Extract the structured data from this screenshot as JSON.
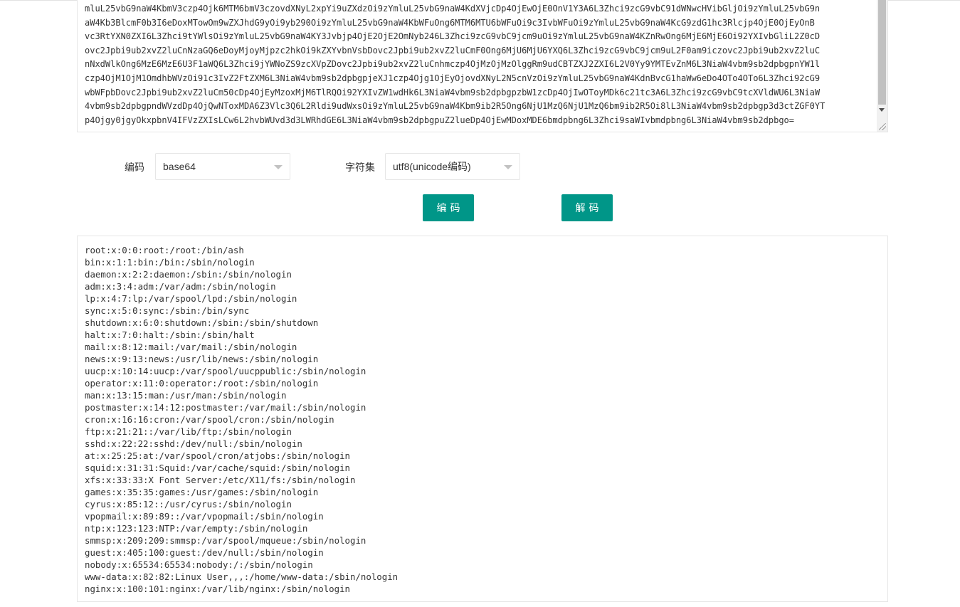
{
  "input": {
    "lines": [
      "mluL25vbG9naW4KbmV3czp4Ojk6MTM6bmV3czovdXNyL2xpYi9uZXdzOi9zYmluL25vbG9naW4KdXVjcDp4OjEwOjE0OnV1Y3A6L3Zhci9zcG9vbC91dWNwcHVibGljOi9zYmluL25vbG9n",
      "aW4Kb3BlcmF0b3I6eDoxMTowOm9wZXJhdG9yOi9yb290Oi9zYmluL25vbG9naW4KbWFuOng6MTM6MTU6bWFuOi9c3IvbWFuOi9zYmluL25vbG9naW4KcG9zdG1hc3Rlcjp4OjE0OjEyOnB",
      "vc3RtYXN0ZXI6L3Zhci9tYWlsOi9zYmluL25vbG9naW4KY3Jvbjp4OjE2OjE2OmNyb246L3Zhci9zcG9vbC9jcm9uOi9zYmluL25vbG9naW4KZnRwOng6MjE6MjE6Oi92YXIvbGliL2Z0cD",
      "ovc2Jpbi9ub2xvZ2luCnNzaGQ6eDoyMjoyMjpzc2hkOi9kZXYvbnVsbDovc2Jpbi9ub2xvZ2luCmF0Ong6MjU6MjU6YXQ6L3Zhci9zcG9vbC9jcm9uL2F0am9iczovc2Jpbi9ub2xvZ2luC",
      "nNxdWlkOng6MzE6MzE6U3F1aWQ6L3Zhci9jYWNoZS9zcXVpZDovc2Jpbi9ub2xvZ2luCnhmczp4OjMzOjMzOlggRm9udCBTZXJ2ZXI6L2V0Yy9YMTEvZnM6L3NiaW4vbm9sb2dpbgpnYW1l",
      "czp4OjM1OjM1OmdhbWVzOi91c3IvZ2FtZXM6L3NiaW4vbm9sb2dpbgpjeXJ1czp4Ojg1OjEyOjovdXNyL2N5cnVzOi9zYmluL25vbG9naW4KdnBvcG1haWw6eDo4OTo4OTo6L3Zhci92cG9",
      "wbWFpbDovc2Jpbi9ub2xvZ2luCm50cDp4OjEyMzoxMjM6TlRQOi92YXIvZW1wdHk6L3NiaW4vbm9sb2dpbgpzbW1zcDp4OjIwOToyMDk6c21tc3A6L3Zhci9zcG9vbC9tcXVldWU6L3NiaW",
      "4vbm9sb2dpbgpndWVzdDp4OjQwNToxMDA6Z3Vlc3Q6L2Rldi9udWxsOi9zYmluL25vbG9naW4Kbm9ib2R5Ong6NjU1MzQ6NjU1MzQ6bm9ib2R5Oi8lL3NiaW4vbm9sb2dpbgp3d3ctZGF0YT",
      "p4Ojgy0jgyOkxpbnV4IFVzZXIsLCw6L2hvbWUvd3d3LWRhdGE6L3NiaW4vbm9sb2dpbgpuZ2lueDp4OjEwMDoxMDE6bmdpbng6L3Zhci9saWIvbmdpbng6L3NiaW4vbm9sb2dpbgo="
    ]
  },
  "form": {
    "encoding_label": "编码",
    "encoding_value": "base64",
    "charset_label": "字符集",
    "charset_value": "utf8(unicode编码)"
  },
  "buttons": {
    "encode_label": "编码",
    "decode_label": "解码"
  },
  "output": {
    "lines": [
      "root:x:0:0:root:/root:/bin/ash",
      "bin:x:1:1:bin:/bin:/sbin/nologin",
      "daemon:x:2:2:daemon:/sbin:/sbin/nologin",
      "adm:x:3:4:adm:/var/adm:/sbin/nologin",
      "lp:x:4:7:lp:/var/spool/lpd:/sbin/nologin",
      "sync:x:5:0:sync:/sbin:/bin/sync",
      "shutdown:x:6:0:shutdown:/sbin:/sbin/shutdown",
      "halt:x:7:0:halt:/sbin:/sbin/halt",
      "mail:x:8:12:mail:/var/mail:/sbin/nologin",
      "news:x:9:13:news:/usr/lib/news:/sbin/nologin",
      "uucp:x:10:14:uucp:/var/spool/uucppublic:/sbin/nologin",
      "operator:x:11:0:operator:/root:/sbin/nologin",
      "man:x:13:15:man:/usr/man:/sbin/nologin",
      "postmaster:x:14:12:postmaster:/var/mail:/sbin/nologin",
      "cron:x:16:16:cron:/var/spool/cron:/sbin/nologin",
      "ftp:x:21:21::/var/lib/ftp:/sbin/nologin",
      "sshd:x:22:22:sshd:/dev/null:/sbin/nologin",
      "at:x:25:25:at:/var/spool/cron/atjobs:/sbin/nologin",
      "squid:x:31:31:Squid:/var/cache/squid:/sbin/nologin",
      "xfs:x:33:33:X Font Server:/etc/X11/fs:/sbin/nologin",
      "games:x:35:35:games:/usr/games:/sbin/nologin",
      "cyrus:x:85:12::/usr/cyrus:/sbin/nologin",
      "vpopmail:x:89:89::/var/vpopmail:/sbin/nologin",
      "ntp:x:123:123:NTP:/var/empty:/sbin/nologin",
      "smmsp:x:209:209:smmsp:/var/spool/mqueue:/sbin/nologin",
      "guest:x:405:100:guest:/dev/null:/sbin/nologin",
      "nobody:x:65534:65534:nobody:/:/sbin/nologin",
      "www-data:x:82:82:Linux User,,,:/home/www-data:/sbin/nologin",
      "nginx:x:100:101:nginx:/var/lib/nginx:/sbin/nologin"
    ]
  },
  "colors": {
    "button_bg": "#009688",
    "border": "#e6e6e6",
    "text": "#333333"
  }
}
